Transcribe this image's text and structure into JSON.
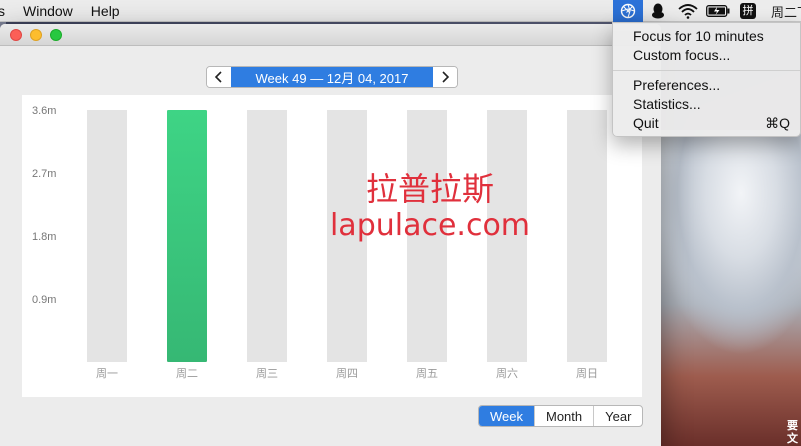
{
  "menubar": {
    "app_menu_partial": "s",
    "items": [
      "Window",
      "Help"
    ],
    "status_clock": "周二下"
  },
  "status_icons": [
    "focus-app-icon",
    "qq-icon",
    "wifi-icon",
    "battery-icon",
    "input-method-icon"
  ],
  "input_method_label": "拼",
  "week_nav": {
    "prev": "‹",
    "label": "Week 49  —  12月 04, 2017",
    "next": "›"
  },
  "chart_data": {
    "type": "bar",
    "categories": [
      "周一",
      "周二",
      "周三",
      "周四",
      "周五",
      "周六",
      "周日"
    ],
    "values": [
      0,
      3.6,
      0,
      0,
      0,
      0,
      0
    ],
    "ymax": 3.6,
    "ticks": [
      "3.6m",
      "2.7m",
      "1.8m",
      "0.9m"
    ],
    "tick_values": [
      3.6,
      2.7,
      1.8,
      0.9
    ],
    "highlight_index": 1,
    "colors": {
      "track": "#e4e4e4",
      "bar_top": "#3ed485",
      "bar_bottom": "#36b874",
      "tick_label": "#777777"
    }
  },
  "watermark": {
    "line1": "拉普拉斯",
    "line2": "lapulace.com"
  },
  "range_tabs": {
    "items": [
      "Week",
      "Month",
      "Year"
    ],
    "active": 0
  },
  "dropdown": {
    "focus10": "Focus for 10 minutes",
    "custom": "Custom focus...",
    "preferences": "Preferences...",
    "statistics": "Statistics...",
    "quit": "Quit",
    "quit_shortcut": "⌘Q"
  },
  "corner_text": "要文"
}
